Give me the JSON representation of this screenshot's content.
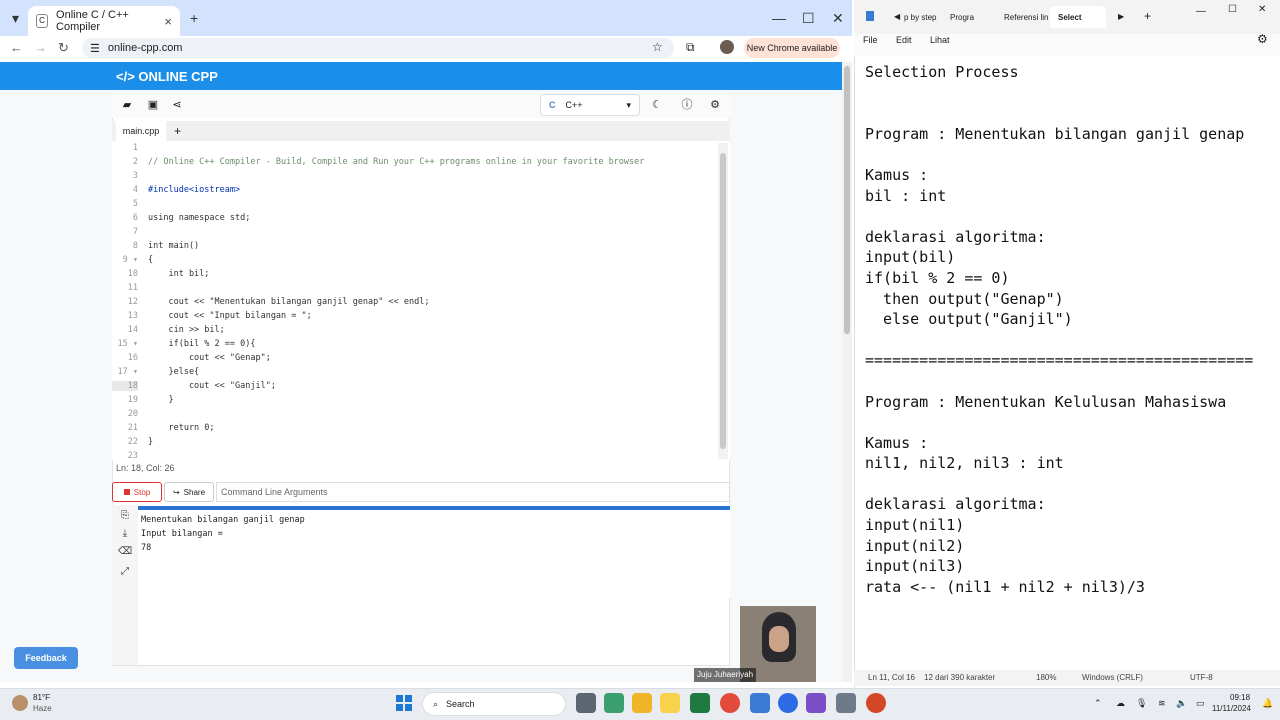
{
  "browser": {
    "tab_title": "Online C / C++ Compiler",
    "favicon": "C",
    "url": "online-cpp.com",
    "new_chrome": "New Chrome available"
  },
  "site": {
    "brand": "</> ONLINE CPP",
    "language": "C++",
    "file_tab": "main.cpp",
    "add_tab": "+",
    "status": "Ln: 18,  Col: 26",
    "stop_label": "Stop",
    "share_label": "Share",
    "cmd_placeholder": "Command Line Arguments",
    "feedback": "Feedback",
    "code_lines": [
      "",
      "// Online C++ Compiler - Build, Compile and Run your C++ programs online in your favorite browser",
      "",
      "#include<iostream>",
      "",
      "using namespace std;",
      "",
      "int main()",
      "{",
      "    int bil;",
      "",
      "    cout << \"Menentukan bilangan ganjil genap\" << endl;",
      "    cout << \"Input bilangan = \";",
      "    cin >> bil;",
      "    if(bil % 2 == 0){",
      "        cout << \"Genap\";",
      "    }else{",
      "        cout << \"Ganjil\";",
      "    }",
      "",
      "    return 0;",
      "}",
      ""
    ],
    "terminal_lines": [
      "Menentukan bilangan ganjil genap",
      "Input bilangan =",
      "78"
    ]
  },
  "webcam": {
    "label": "Juju Juhaeriyah"
  },
  "notepad": {
    "tabs": [
      "p by step",
      "Progra",
      "Referensi lin",
      "Select"
    ],
    "add_tab": "+",
    "menu": [
      "File",
      "Edit",
      "Lihat"
    ],
    "lines": [
      "Selection Process",
      "",
      "",
      "Program : Menentukan bilangan ganjil genap",
      "",
      "Kamus :",
      "bil : int",
      "",
      "deklarasi algoritma:",
      "input(bil)",
      "if(bil % 2 == 0)",
      "  then output(\"Genap\")",
      "  else output(\"Ganjil\")",
      "",
      "===========================================",
      "",
      "Program : Menentukan Kelulusan Mahasiswa",
      "",
      "Kamus :",
      "nil1, nil2, nil3 : int",
      "",
      "deklarasi algoritma:",
      "input(nil1)",
      "input(nil2)",
      "input(nil3)",
      "rata <-- (nil1 + nil2 + nil3)/3"
    ],
    "status": [
      "Ln 11, Col 16",
      "12 dari 390 karakter",
      "180%",
      "Windows (CRLF)",
      "UTF-8"
    ]
  },
  "taskbar": {
    "weather_temp": "81°F",
    "weather_desc": "Haze",
    "search": "Search",
    "time": "09:18",
    "date": "11/11/2024"
  },
  "colors": {
    "accent": "#1a8ee8",
    "stop": "#dd3333",
    "selection": "#a8c9ef"
  }
}
